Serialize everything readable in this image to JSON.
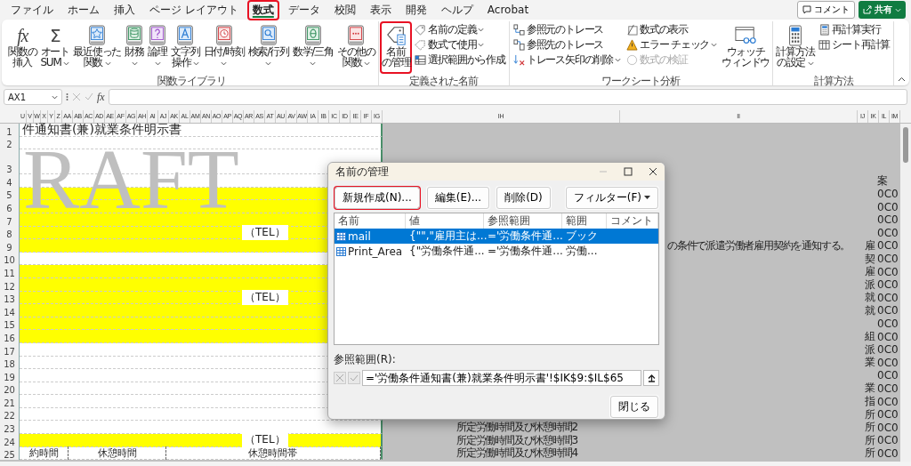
{
  "tabs": [
    {
      "label": "ファイル",
      "selected": false,
      "annotated": false
    },
    {
      "label": "ホーム",
      "selected": false,
      "annotated": false
    },
    {
      "label": "挿入",
      "selected": false,
      "annotated": false
    },
    {
      "label": "ページ レイアウト",
      "selected": false,
      "annotated": false
    },
    {
      "label": "数式",
      "selected": true,
      "annotated": true
    },
    {
      "label": "データ",
      "selected": false,
      "annotated": false
    },
    {
      "label": "校閲",
      "selected": false,
      "annotated": false
    },
    {
      "label": "表示",
      "selected": false,
      "annotated": false
    },
    {
      "label": "開発",
      "selected": false,
      "annotated": false
    },
    {
      "label": "ヘルプ",
      "selected": false,
      "annotated": false
    },
    {
      "label": "Acrobat",
      "selected": false,
      "annotated": false
    }
  ],
  "header_buttons": {
    "comment": "コメント",
    "share": "共有"
  },
  "ribbon": {
    "groups": [
      {
        "title": "関数ライブラリ",
        "items": [
          {
            "kind": "large",
            "glyph": "fx",
            "lines": [
              "関数の",
              "挿入"
            ],
            "menu": false,
            "annotated": false
          },
          {
            "kind": "large",
            "glyph": "Σ",
            "lines": [
              "オート",
              "SUM"
            ],
            "menu": true,
            "annotated": false
          },
          {
            "kind": "large",
            "lines": [
              "最近使った",
              "関数"
            ],
            "menu": true,
            "annotated": false
          },
          {
            "kind": "large",
            "lines": [
              "財務"
            ],
            "menu": true,
            "annotated": false
          },
          {
            "kind": "large",
            "lines": [
              "論理"
            ],
            "menu": true,
            "annotated": false
          },
          {
            "kind": "large",
            "lines": [
              "文字列",
              "操作"
            ],
            "menu": true,
            "annotated": false
          },
          {
            "kind": "large",
            "lines": [
              "日付/時刻"
            ],
            "menu": true,
            "annotated": false
          },
          {
            "kind": "large",
            "lines": [
              "検索/行列"
            ],
            "menu": true,
            "annotated": false
          },
          {
            "kind": "large",
            "lines": [
              "数学/三角"
            ],
            "menu": true,
            "annotated": false
          },
          {
            "kind": "large",
            "lines": [
              "その他の",
              "関数"
            ],
            "menu": true,
            "annotated": false
          }
        ]
      },
      {
        "title": "定義された名前",
        "items": [
          {
            "kind": "large",
            "lines": [
              "名前",
              "の管理"
            ],
            "menu": false,
            "annotated": true
          },
          {
            "kind": "column",
            "items": [
              {
                "label": "名前の定義",
                "menu": true,
                "disabled": false
              },
              {
                "label": "数式で使用",
                "menu": true,
                "disabled": false
              },
              {
                "label": "選択範囲から作成",
                "menu": false,
                "disabled": false
              }
            ]
          }
        ]
      },
      {
        "title": "ワークシート分析",
        "items": [
          {
            "kind": "column",
            "items": [
              {
                "label": "参照元のトレース",
                "menu": false,
                "disabled": false
              },
              {
                "label": "参照先のトレース",
                "menu": false,
                "disabled": false
              },
              {
                "label": "トレース矢印の削除",
                "menu": true,
                "disabled": false
              }
            ]
          },
          {
            "kind": "column",
            "items": [
              {
                "label": "数式の表示",
                "menu": false,
                "disabled": false
              },
              {
                "label": "エラー チェック",
                "menu": true,
                "disabled": false
              },
              {
                "label": "数式の検証",
                "menu": false,
                "disabled": true
              }
            ]
          },
          {
            "kind": "large",
            "lines": [
              "ウォッチ",
              "ウィンドウ"
            ],
            "menu": false,
            "annotated": false
          }
        ]
      },
      {
        "title": "計算方法",
        "items": [
          {
            "kind": "large",
            "lines": [
              "計算方法",
              "の設定"
            ],
            "menu": true,
            "annotated": false
          },
          {
            "kind": "column",
            "items": [
              {
                "label": "再計算実行",
                "menu": false,
                "disabled": false
              },
              {
                "label": "シート再計算",
                "menu": false,
                "disabled": false
              }
            ]
          }
        ]
      }
    ]
  },
  "formula_bar": {
    "name_box": "AX1",
    "fx_label": "fx"
  },
  "columns": [
    {
      "label": "U",
      "kind": "single"
    },
    {
      "label": "V",
      "kind": "single"
    },
    {
      "label": "W",
      "kind": "single"
    },
    {
      "label": "X",
      "kind": "single"
    },
    {
      "label": "Y",
      "kind": "single"
    },
    {
      "label": "Z",
      "kind": "single"
    },
    {
      "label": "AA",
      "kind": "double"
    },
    {
      "label": "AB",
      "kind": "double"
    },
    {
      "label": "AC",
      "kind": "double"
    },
    {
      "label": "AD",
      "kind": "double"
    },
    {
      "label": "AE",
      "kind": "double"
    },
    {
      "label": "AF",
      "kind": "double"
    },
    {
      "label": "AG",
      "kind": "double"
    },
    {
      "label": "AH",
      "kind": "double"
    },
    {
      "label": "AI",
      "kind": "double"
    },
    {
      "label": "AJ",
      "kind": "double"
    },
    {
      "label": "AK",
      "kind": "double"
    },
    {
      "label": "AL",
      "kind": "double"
    },
    {
      "label": "AM",
      "kind": "double"
    },
    {
      "label": "AN",
      "kind": "double"
    },
    {
      "label": "AO",
      "kind": "double"
    },
    {
      "label": "AP",
      "kind": "double"
    },
    {
      "label": "AQ",
      "kind": "double"
    },
    {
      "label": "AR",
      "kind": "double"
    },
    {
      "label": "AS",
      "kind": "double"
    },
    {
      "label": "AT",
      "kind": "double"
    },
    {
      "label": "AU",
      "kind": "double"
    },
    {
      "label": "AV",
      "kind": "double"
    },
    {
      "label": "AW",
      "kind": "double"
    },
    {
      "label": "IA",
      "kind": "double"
    },
    {
      "label": "IB",
      "kind": "double"
    },
    {
      "label": "IC",
      "kind": "double"
    },
    {
      "label": "ID",
      "kind": "double"
    },
    {
      "label": "IE",
      "kind": "double"
    },
    {
      "label": "IF",
      "kind": "double"
    },
    {
      "label": "IG",
      "kind": "double"
    },
    {
      "label": "IH",
      "kind": "wide"
    },
    {
      "label": "II",
      "kind": "wide"
    },
    {
      "label": "IJ",
      "kind": "double"
    },
    {
      "label": "IK",
      "kind": "double"
    },
    {
      "label": "IL",
      "kind": "double"
    },
    {
      "label": "IM",
      "kind": "double"
    }
  ],
  "watermark": "RAFT",
  "rows": [
    {
      "number": "1",
      "tall": false,
      "highlighted": false,
      "title": "件通知書(兼)就業条件明示書"
    },
    {
      "number": "2",
      "tall": false,
      "highlighted": false
    },
    {
      "number": "3",
      "tall": true,
      "highlighted": false
    },
    {
      "number": "4",
      "tall": false,
      "highlighted": false,
      "value": "案"
    },
    {
      "number": "5",
      "tall": false,
      "highlighted": true,
      "value": "0C0"
    },
    {
      "number": "6",
      "tall": false,
      "highlighted": true,
      "value": "0C0"
    },
    {
      "number": "7",
      "tall": false,
      "highlighted": true,
      "value": "0C0"
    },
    {
      "number": "8",
      "tall": false,
      "highlighted": true,
      "tel": "（TEL）",
      "value": "0C0"
    },
    {
      "number": "9",
      "tall": false,
      "highlighted": true,
      "note": {
        "kind": "sentence",
        "text": "の条件で派遣労働者雇用契約を通知する。"
      },
      "mark": "雇",
      "value": "0C0"
    },
    {
      "number": "10",
      "tall": false,
      "highlighted": false,
      "mark": "契",
      "value": "0C0"
    },
    {
      "number": "11",
      "tall": false,
      "highlighted": true,
      "mark": "雇",
      "value": "0C0"
    },
    {
      "number": "12",
      "tall": false,
      "highlighted": true,
      "mark": "派",
      "value": "0C0"
    },
    {
      "number": "13",
      "tall": false,
      "highlighted": true,
      "tel": "（TEL）",
      "mark": "就",
      "value": "0C0"
    },
    {
      "number": "14",
      "tall": false,
      "highlighted": true,
      "mark": "就",
      "value": "0C0"
    },
    {
      "number": "15",
      "tall": false,
      "highlighted": true,
      "value": "0C0"
    },
    {
      "number": "16",
      "tall": false,
      "highlighted": true,
      "mark": "組",
      "value": "0C0"
    },
    {
      "number": "17",
      "tall": false,
      "highlighted": false,
      "mark": "派",
      "value": "0C0"
    },
    {
      "number": "18",
      "tall": false,
      "highlighted": false,
      "mark": "業",
      "value": "0C0"
    },
    {
      "number": "19",
      "tall": false,
      "highlighted": false,
      "value": "0C0"
    },
    {
      "number": "20",
      "tall": false,
      "highlighted": false,
      "mark": "業",
      "value": "0C0"
    },
    {
      "number": "21",
      "tall": false,
      "highlighted": false,
      "mark": "指",
      "value": "0C0"
    },
    {
      "number": "22",
      "tall": false,
      "highlighted": false,
      "mark": "所",
      "value": "0C0"
    },
    {
      "number": "23",
      "tall": false,
      "highlighted": false,
      "note": {
        "kind": "item",
        "text": "所定労働時間及び休憩時間2"
      },
      "mark": "所",
      "value": "0C0"
    },
    {
      "number": "24",
      "tall": false,
      "highlighted": true,
      "tel": "（TEL）",
      "note": {
        "kind": "item",
        "text": "所定労働時間及び休憩時間3"
      },
      "mark": "所",
      "value": "0C0"
    },
    {
      "number": "25",
      "tall": false,
      "highlighted": false,
      "cells": [
        "約時間",
        "休憩時間",
        "休憩時間帯"
      ],
      "note": {
        "kind": "item",
        "text": "所定労働時間及び休憩時間4"
      },
      "mark": "所",
      "value": "0C0"
    }
  ],
  "dialog": {
    "title": "名前の管理",
    "buttons": [
      {
        "label": "新規作成(N)...",
        "annotated": true
      },
      {
        "label": "編集(E)...",
        "annotated": false
      },
      {
        "label": "削除(D)",
        "annotated": false
      }
    ],
    "filter": "フィルター(F)",
    "columns": [
      "名前",
      "値",
      "参照範囲",
      "範囲",
      "コメント"
    ],
    "rows": [
      {
        "selected": true,
        "cells": [
          "mail",
          "{\"\",\"雇用主は...",
          "='労働条件通...",
          "ブック"
        ]
      },
      {
        "selected": false,
        "cells": [
          "Print_Area",
          "{\"労働条件通...",
          "='労働条件通...",
          "労働..."
        ]
      }
    ],
    "refers_label": "参照範囲(R):",
    "refers_value": "='労働条件通知書(兼)就業条件明示書'!$IK$9:$IL$65",
    "close": "閉じる"
  }
}
